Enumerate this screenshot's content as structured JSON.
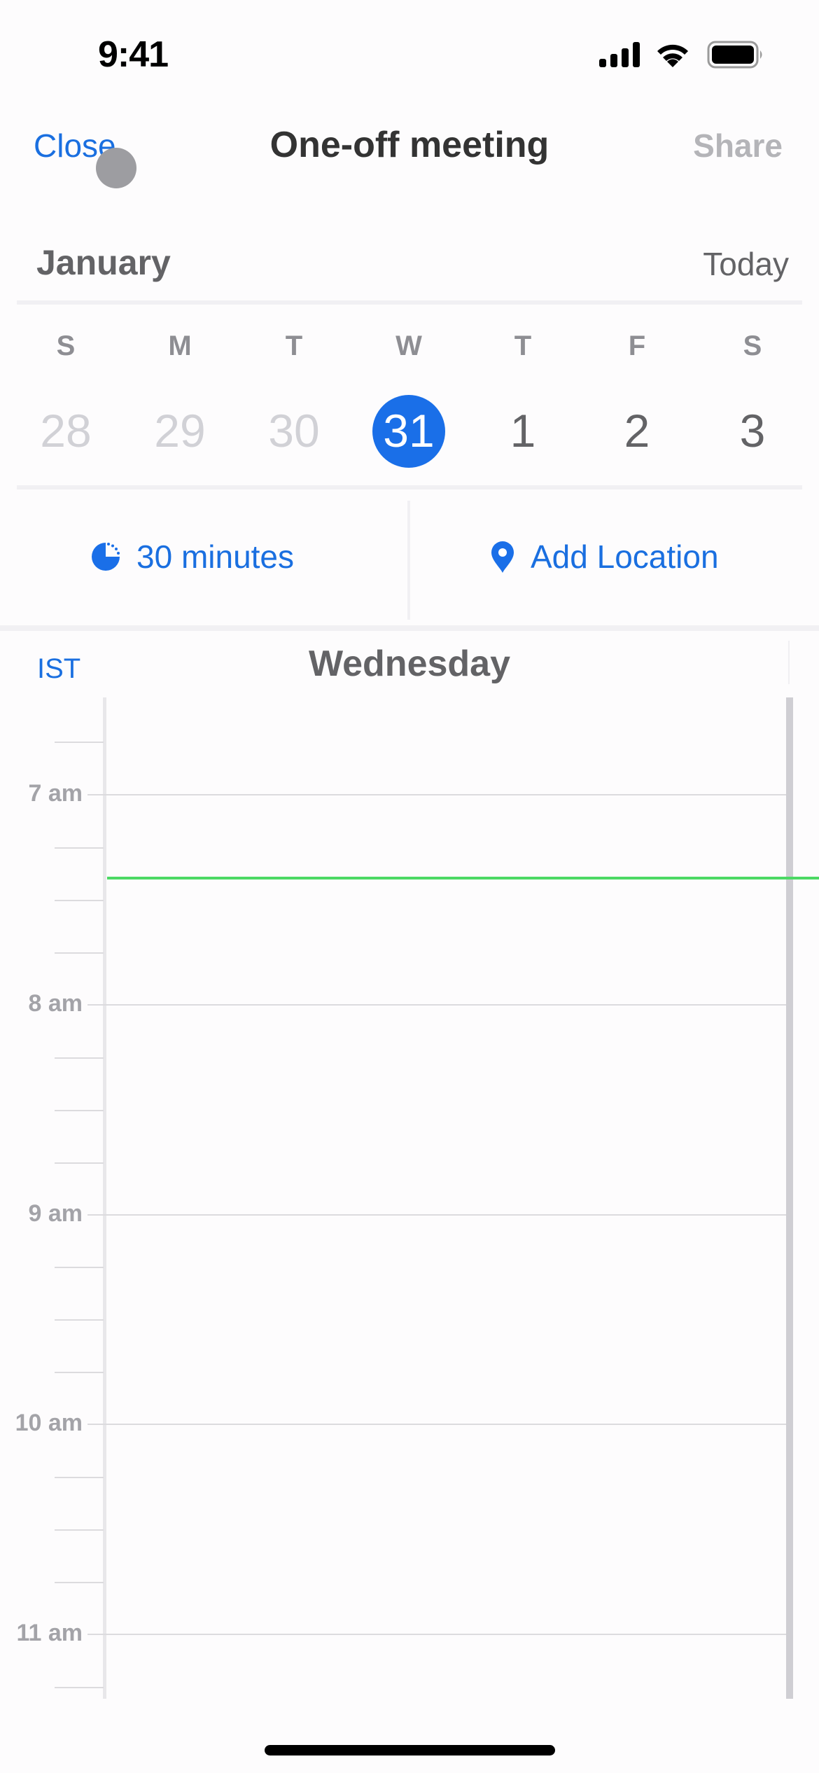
{
  "status_bar": {
    "time": "9:41",
    "icons": [
      "cellular-signal-icon",
      "wifi-icon",
      "battery-icon"
    ]
  },
  "header": {
    "close_label": "Close",
    "title": "One-off meeting",
    "share_label": "Share"
  },
  "calendar": {
    "month": "January",
    "today_label": "Today",
    "weekdays": [
      "S",
      "M",
      "T",
      "W",
      "T",
      "F",
      "S"
    ],
    "dates": [
      {
        "day": "28",
        "state": "past"
      },
      {
        "day": "29",
        "state": "past"
      },
      {
        "day": "30",
        "state": "past"
      },
      {
        "day": "31",
        "state": "selected"
      },
      {
        "day": "1",
        "state": "future"
      },
      {
        "day": "2",
        "state": "future"
      },
      {
        "day": "3",
        "state": "future"
      }
    ]
  },
  "options": {
    "duration_label": "30 minutes",
    "duration_icon": "duration-pie-icon",
    "location_label": "Add Location",
    "location_icon": "location-pin-icon"
  },
  "day_view": {
    "timezone": "IST",
    "day_name": "Wednesday",
    "hours": [
      "7 am",
      "8 am",
      "9 am",
      "10 am",
      "11 am"
    ],
    "current_time_indicator": "~7:24 am"
  },
  "colors": {
    "accent": "#1a6fe8",
    "now_line": "#4cd964",
    "muted_text": "#636366"
  }
}
